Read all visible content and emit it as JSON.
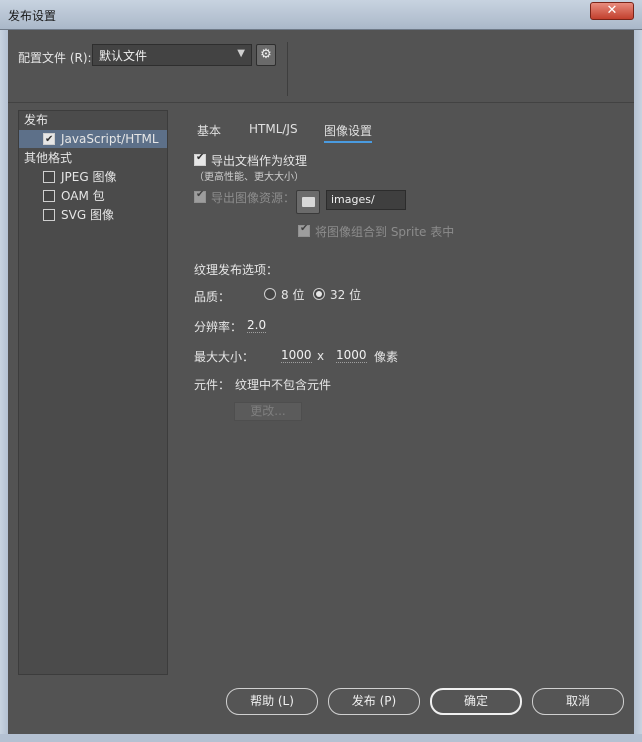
{
  "window": {
    "title": "发布设置",
    "close_label": "✕"
  },
  "profile": {
    "label": "配置文件 (R):",
    "value": "默认文件",
    "gear_glyph": "⚙"
  },
  "tree": {
    "publish_header": "发布",
    "javascript_html": "JavaScript/HTML",
    "other_formats_header": "其他格式",
    "jpeg": "JPEG 图像",
    "oam": "OAM 包",
    "svg": "SVG 图像"
  },
  "tabs": {
    "basic": "基本",
    "html_js": "HTML/JS",
    "image_settings": "图像设置"
  },
  "image": {
    "export_texture": "导出文档作为纹理",
    "export_texture_hint": "（更高性能、更大大小）",
    "export_assets_label": "导出图像资源：",
    "assets_path": "images/",
    "combine_sprite": "将图像组合到 Sprite 表中",
    "texture_options_label": "纹理发布选项：",
    "quality_label": "品质：",
    "quality_8": "8 位",
    "quality_32": "32 位",
    "resolution_label": "分辨率：",
    "resolution_value": "2.0",
    "max_size_label": "最大大小：",
    "max_width": "1000",
    "times": "x",
    "max_height": "1000",
    "pixels": "像素",
    "symbols_label": "元件：",
    "symbols_value": "纹理中不包含元件",
    "change_button": "更改..."
  },
  "buttons": {
    "help": "帮助 (L)",
    "publish": "发布 (P)",
    "ok": "确定",
    "cancel": "取消"
  },
  "colors": {
    "panel_bg": "#535353",
    "selection": "#5d7089",
    "tab_underline": "#4a9be0"
  }
}
